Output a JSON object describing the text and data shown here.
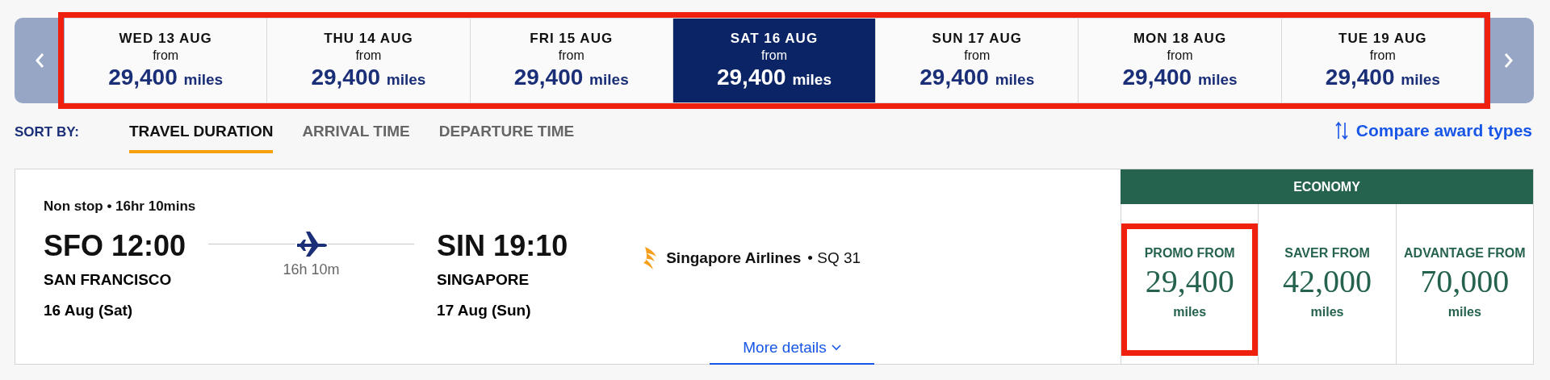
{
  "date_strip": {
    "highlighted": true,
    "dates": [
      {
        "day": "WED 13 AUG",
        "from": "from",
        "amount": "29,400",
        "unit": "miles",
        "selected": false
      },
      {
        "day": "THU 14 AUG",
        "from": "from",
        "amount": "29,400",
        "unit": "miles",
        "selected": false
      },
      {
        "day": "FRI 15 AUG",
        "from": "from",
        "amount": "29,400",
        "unit": "miles",
        "selected": false
      },
      {
        "day": "SAT 16 AUG",
        "from": "from",
        "amount": "29,400",
        "unit": "miles",
        "selected": true
      },
      {
        "day": "SUN 17 AUG",
        "from": "from",
        "amount": "29,400",
        "unit": "miles",
        "selected": false
      },
      {
        "day": "MON 18 AUG",
        "from": "from",
        "amount": "29,400",
        "unit": "miles",
        "selected": false
      },
      {
        "day": "TUE 19 AUG",
        "from": "from",
        "amount": "29,400",
        "unit": "miles",
        "selected": false
      }
    ]
  },
  "sort": {
    "label": "SORT BY:",
    "options": [
      {
        "label": "TRAVEL DURATION",
        "selected": true
      },
      {
        "label": "ARRIVAL TIME",
        "selected": false
      },
      {
        "label": "DEPARTURE TIME",
        "selected": false
      }
    ],
    "compare_link": "Compare award types"
  },
  "flight": {
    "summary": "Non stop • 16hr 10mins",
    "departure": {
      "code_time": "SFO 12:00",
      "city": "SAN FRANCISCO",
      "date": "16 Aug (Sat)"
    },
    "duration": "16h 10m",
    "arrival": {
      "code_time": "SIN 19:10",
      "city": "SINGAPORE",
      "date": "17 Aug (Sun)"
    },
    "airline": "Singapore Airlines",
    "flight_number": "• SQ 31",
    "more_details": "More details",
    "cabin": "ECONOMY",
    "fares": [
      {
        "label": "PROMO FROM",
        "amount": "29,400",
        "unit": "miles",
        "highlighted": true
      },
      {
        "label": "SAVER FROM",
        "amount": "42,000",
        "unit": "miles",
        "highlighted": false
      },
      {
        "label": "ADVANTAGE FROM",
        "amount": "70,000",
        "unit": "miles",
        "highlighted": false
      }
    ]
  }
}
